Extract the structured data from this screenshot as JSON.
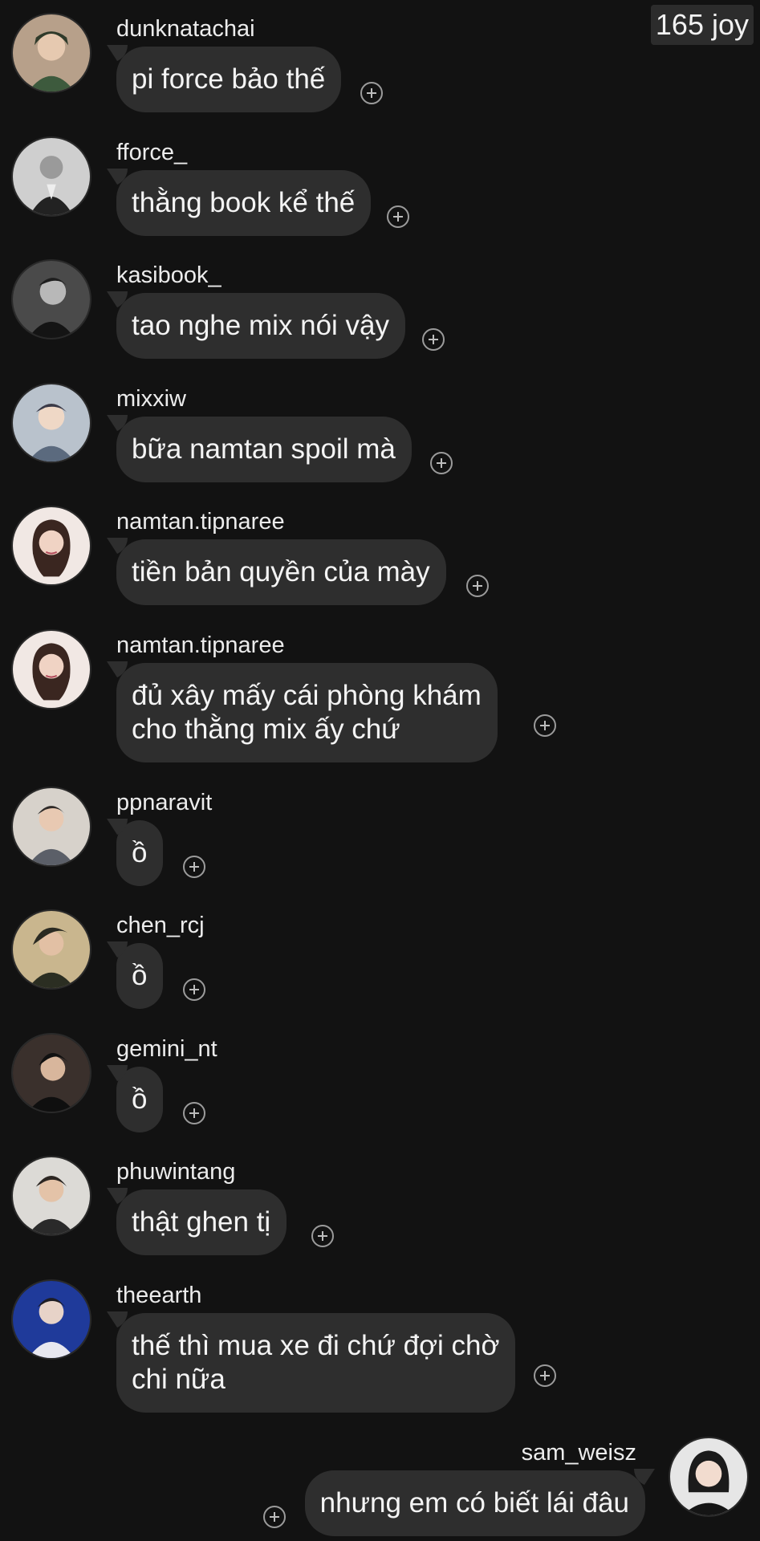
{
  "header": {
    "counter_label": "165 joy"
  },
  "messages": [
    {
      "username": "dunknatachai",
      "text": "pi force bảo thế",
      "avatar_color": "#8a7a6a"
    },
    {
      "username": "fforce_",
      "text": "thằng book kể thế",
      "avatar_color": "#6f6f6f"
    },
    {
      "username": "kasibook_",
      "text": "tao nghe mix nói vậy",
      "avatar_color": "#3b3b3b"
    },
    {
      "username": "mixxiw",
      "text": "bữa namtan spoil mà",
      "avatar_color": "#9aa3b2"
    },
    {
      "username": "namtan.tipnaree",
      "text": "tiền bản quyền của mày",
      "avatar_color": "#d8c2b8"
    },
    {
      "username": "namtan.tipnaree",
      "text": "đủ xây mấy cái phòng khám\ncho thằng mix ấy chứ",
      "avatar_color": "#d8c2b8"
    },
    {
      "username": "ppnaravit",
      "text": "ồ",
      "avatar_color": "#8d8a86"
    },
    {
      "username": "chen_rcj",
      "text": "ồ",
      "avatar_color": "#7a6f5a"
    },
    {
      "username": "gemini_nt",
      "text": "ồ",
      "avatar_color": "#3d3330"
    },
    {
      "username": "phuwintang",
      "text": "thật ghen tị",
      "avatar_color": "#8c8680"
    },
    {
      "username": "theearth",
      "text": "thế thì mua xe đi chứ đợi chờ\nchi nữa",
      "avatar_color": "#2a3f8a"
    },
    {
      "username": "sam_weisz",
      "text": "nhưng em có biết lái đâu",
      "avatar_color": "#d9d9d9"
    }
  ],
  "colors": {
    "background": "#121212",
    "bubble": "#2e2e2e",
    "text": "#f4f4f4"
  }
}
